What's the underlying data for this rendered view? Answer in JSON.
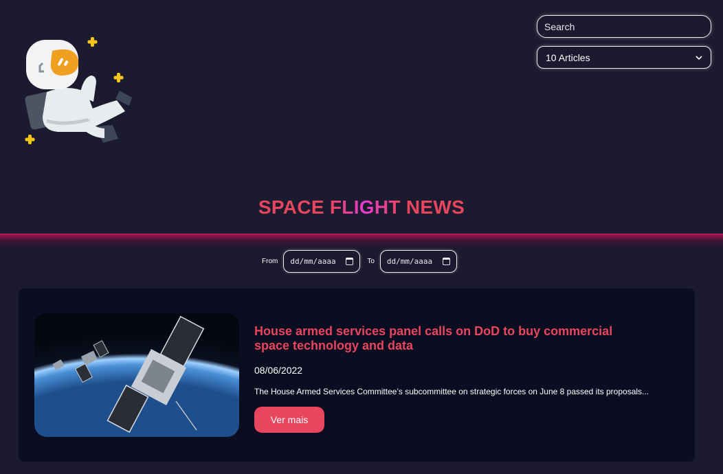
{
  "header": {
    "logo_icon": "astronaut-icon",
    "search": {
      "placeholder": "Search",
      "value": ""
    },
    "articles_select": {
      "selected": "10 Articles",
      "icon": "chevron-down-icon"
    }
  },
  "title": {
    "part1": "SPACE ",
    "part2": "FLIGHT",
    "part3": " NEWS"
  },
  "filter": {
    "from_label": "From",
    "to_label": "To",
    "from_placeholder": "dd/mm/aaaa",
    "to_placeholder": "dd/mm/aaaa",
    "icon": "calendar-icon"
  },
  "articles": [
    {
      "title": "House armed services panel calls on DoD to buy commercial space technology and data",
      "date": "08/06/2022",
      "summary": "The House Armed Services Committee’s subcommittee on strategic forces on June 8 passed its proposals...",
      "button_label": "Ver mais"
    }
  ],
  "colors": {
    "background": "#1b1a2e",
    "card": "#0b0d20",
    "accent": "#e8465f",
    "title_gradient_mid": "#e23bd0"
  }
}
